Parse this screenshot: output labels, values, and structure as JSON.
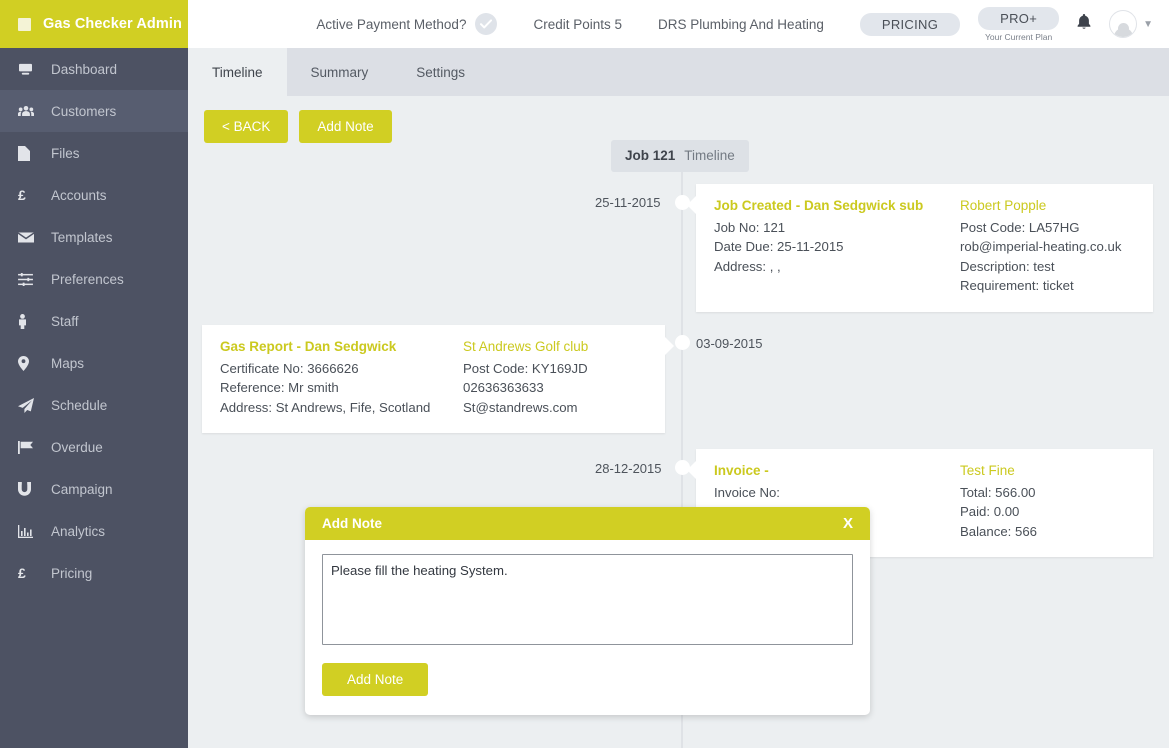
{
  "sidebar": {
    "brand": "Gas Checker Admin",
    "items": [
      {
        "label": "Dashboard",
        "icon": "dashboard-icon",
        "active": false
      },
      {
        "label": "Customers",
        "icon": "customers-icon",
        "active": true
      },
      {
        "label": "Files",
        "icon": "file-icon",
        "active": false
      },
      {
        "label": "Accounts",
        "icon": "pound-icon",
        "active": false
      },
      {
        "label": "Templates",
        "icon": "envelope-icon",
        "active": false
      },
      {
        "label": "Preferences",
        "icon": "sliders-icon",
        "active": false
      },
      {
        "label": "Staff",
        "icon": "person-icon",
        "active": false
      },
      {
        "label": "Maps",
        "icon": "map-pin-icon",
        "active": false
      },
      {
        "label": "Schedule",
        "icon": "paper-plane-icon",
        "active": false
      },
      {
        "label": "Overdue",
        "icon": "flag-icon",
        "active": false
      },
      {
        "label": "Campaign",
        "icon": "magnet-icon",
        "active": false
      },
      {
        "label": "Analytics",
        "icon": "bar-chart-icon",
        "active": false
      },
      {
        "label": "Pricing",
        "icon": "pound-icon",
        "active": false
      }
    ]
  },
  "header": {
    "payment_label": "Active Payment Method?",
    "credit_points": "Credit Points 5",
    "company": "DRS Plumbing And Heating",
    "pricing_pill": "PRICING",
    "plan_pill": "PRO+",
    "plan_caption": "Your Current Plan"
  },
  "tabs": [
    {
      "label": "Timeline",
      "active": true
    },
    {
      "label": "Summary",
      "active": false
    },
    {
      "label": "Settings",
      "active": false
    }
  ],
  "toolbar": {
    "back_label": "< BACK",
    "add_note_label": "Add Note"
  },
  "timeline": {
    "header_job": "Job 121",
    "header_sub": "Timeline",
    "entries": [
      {
        "date": "25-11-2015",
        "side": "right",
        "left_col": {
          "title": "Job Created - Dan Sedgwick sub",
          "lines": [
            "Job No: 121",
            "Date Due: 25-11-2015",
            "Address: , ,"
          ]
        },
        "right_col": {
          "title": "Robert Popple",
          "lines": [
            "Post Code: LA57HG",
            "rob@imperial-heating.co.uk",
            "Description: test",
            "Requirement: ticket"
          ]
        }
      },
      {
        "date": "03-09-2015",
        "side": "left",
        "left_col": {
          "title": "Gas Report - Dan Sedgwick",
          "lines": [
            "Certificate No: 3666626",
            "Reference: Mr smith",
            "Address: St Andrews, Fife, Scotland"
          ]
        },
        "right_col": {
          "title": "St Andrews Golf club",
          "lines": [
            "Post Code: KY169JD",
            "02636363633",
            "St@standrews.com"
          ]
        }
      },
      {
        "date": "28-12-2015",
        "side": "right",
        "left_col": {
          "title": "Invoice -",
          "lines": [
            "Invoice No:",
            ""
          ]
        },
        "right_col": {
          "title": "Test Fine",
          "lines": [
            "Total: 566.00",
            "Paid: 0.00",
            "Balance: 566"
          ]
        }
      }
    ]
  },
  "modal": {
    "title": "Add Note",
    "close_label": "X",
    "note_value": "Please fill the heating System.",
    "note_placeholder": "",
    "submit_label": "Add Note"
  },
  "colors": {
    "brand_yellow": "#d1cf23",
    "sidebar_dark": "#4d5263",
    "page_bg": "#eceff1",
    "tabstrip": "#dcdfe5",
    "title_yellow": "#cbc91f"
  }
}
